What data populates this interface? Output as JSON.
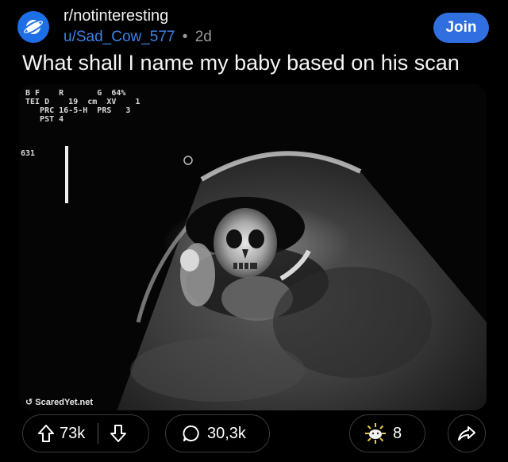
{
  "post": {
    "subreddit": "r/notinteresting",
    "author": "u/Sad_Cow_577",
    "separator": "•",
    "age": "2d",
    "join_label": "Join",
    "title": "What shall I name my baby based on his scan"
  },
  "scan": {
    "header_text": "B F    R       G  64%\nTEI D    19  cm  XV    1\n   PRC 16-5-H  PRS   3\n   PST 4",
    "depth_marker": "631",
    "watermark": "ScaredYet.net"
  },
  "actions": {
    "upvotes": "73k",
    "comments": "30,3k",
    "awards": "8"
  },
  "colors": {
    "accent": "#2f6fe0",
    "username": "#3d82e6",
    "subreddit_avatar": "#1d6fe6"
  },
  "icons": [
    "subreddit-planet-icon",
    "upvote-icon",
    "downvote-icon",
    "comment-icon",
    "award-icon",
    "share-icon"
  ]
}
